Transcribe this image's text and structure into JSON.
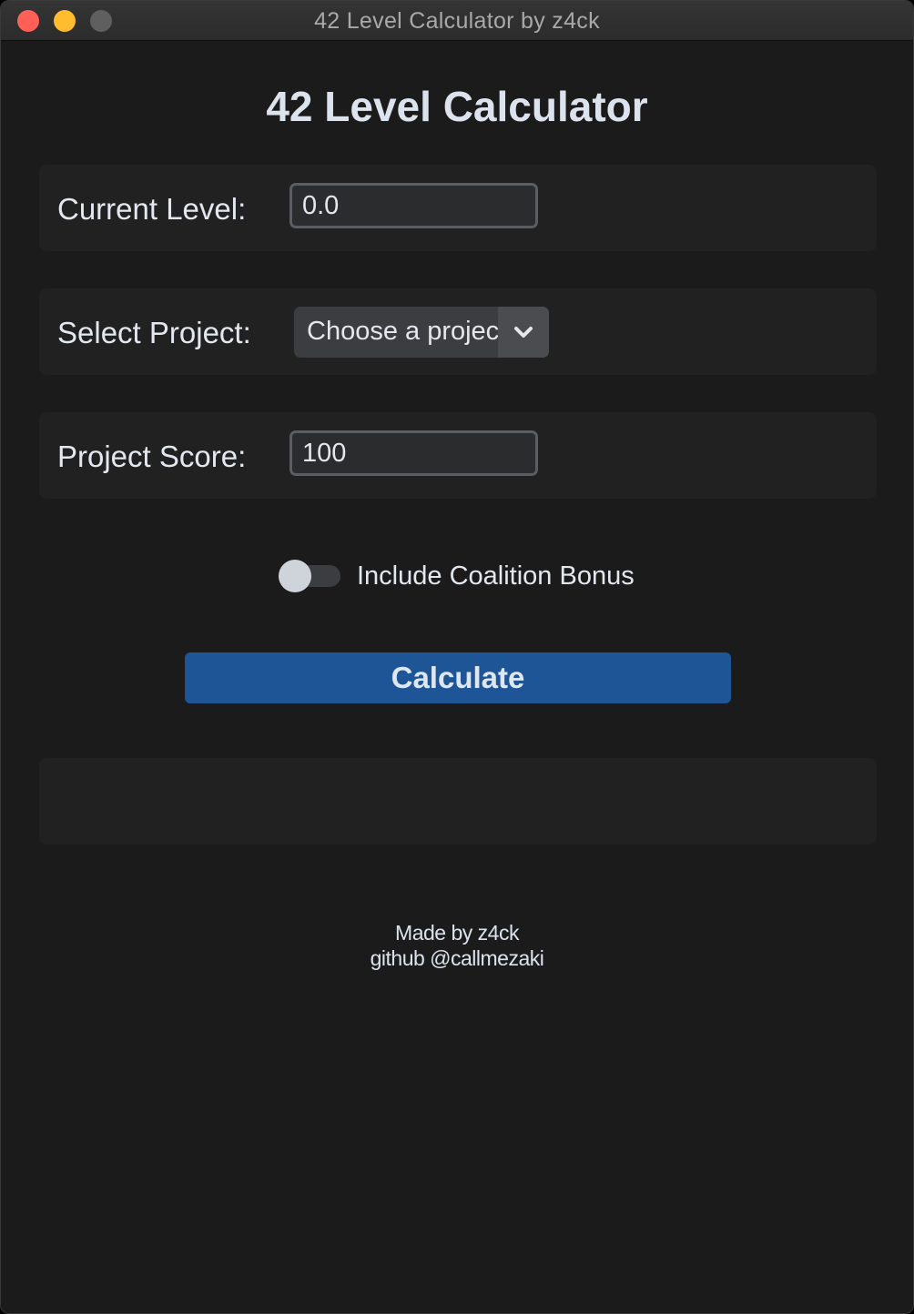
{
  "window": {
    "title": "42 Level Calculator by z4ck"
  },
  "app": {
    "title": "42 Level Calculator"
  },
  "current_level": {
    "label": "Current Level:",
    "value": "0.0"
  },
  "project": {
    "label": "Select Project:",
    "selected": "Choose a project",
    "icon": "chevron-down-icon"
  },
  "score": {
    "label": "Project Score:",
    "value": "100"
  },
  "coalition": {
    "label": "Include Coalition Bonus",
    "enabled": false
  },
  "calculate": {
    "label": "Calculate"
  },
  "result": {
    "text": ""
  },
  "footer": {
    "line1": "Made by z4ck",
    "line2": "github @callmezaki"
  },
  "colors": {
    "background": "#1b1b1c",
    "panel": "#212122",
    "accent": "#1e5597",
    "text": "#e3e7ee"
  }
}
